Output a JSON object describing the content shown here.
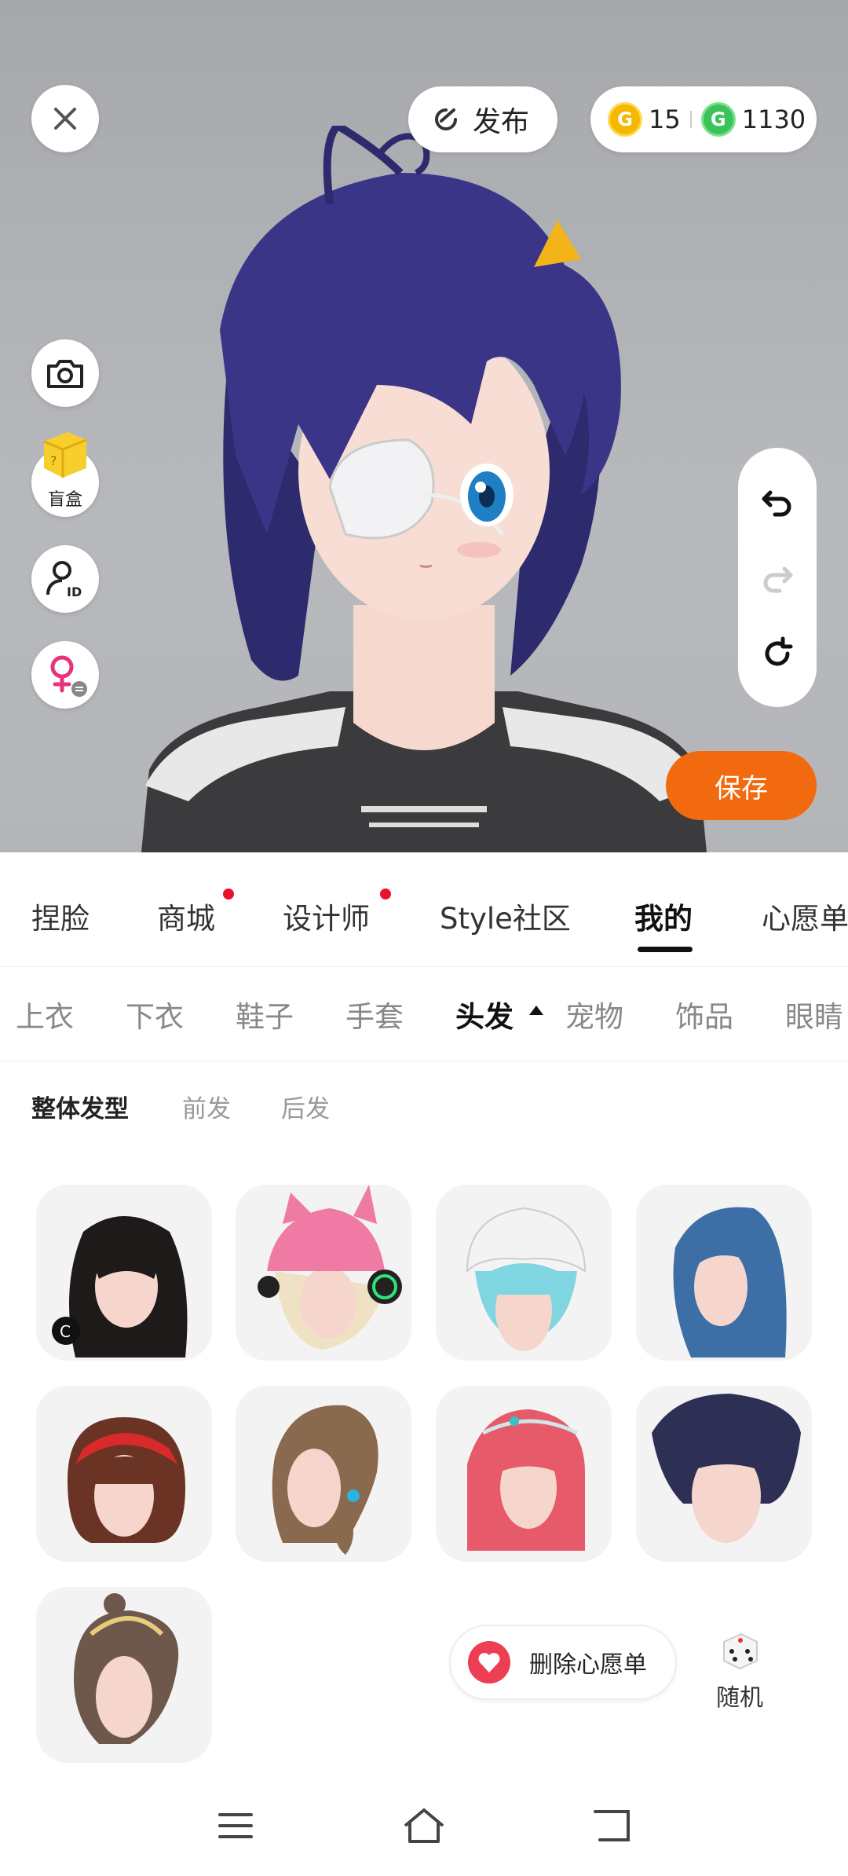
{
  "header": {
    "close_icon": "close-icon",
    "publish_label": "发布",
    "gold_coins": "15",
    "green_coins": "1130"
  },
  "left_tools": {
    "blindbox_label": "盲盒"
  },
  "save_label": "保存",
  "main_tabs": [
    {
      "label": "捏脸",
      "dot": false
    },
    {
      "label": "商城",
      "dot": true
    },
    {
      "label": "设计师",
      "dot": true
    },
    {
      "label": "Style社区",
      "dot": false
    },
    {
      "label": "我的",
      "dot": false,
      "active": true
    },
    {
      "label": "心愿单",
      "dot": false
    }
  ],
  "category_tabs": [
    {
      "label": "上衣"
    },
    {
      "label": "下衣"
    },
    {
      "label": "鞋子"
    },
    {
      "label": "手套"
    },
    {
      "label": "头发",
      "active": true
    },
    {
      "label": "宠物"
    },
    {
      "label": "饰品"
    },
    {
      "label": "眼睛"
    }
  ],
  "hair_subtabs": [
    {
      "label": "整体发型",
      "active": true
    },
    {
      "label": "前发"
    },
    {
      "label": "后发"
    }
  ],
  "hair_items": [
    {
      "name": "black-long-hair"
    },
    {
      "name": "pink-cat-cap-hair"
    },
    {
      "name": "cyan-bonnet-hair"
    },
    {
      "name": "blue-long-hair"
    },
    {
      "name": "brown-bob-hair"
    },
    {
      "name": "brown-side-ponytail-hair"
    },
    {
      "name": "pink-tiara-hair"
    },
    {
      "name": "navy-short-hair"
    },
    {
      "name": "updo-hair"
    }
  ],
  "wishlist_button": "删除心愿单",
  "random_label": "随机",
  "colors": {
    "accent": "#f26a0f",
    "active_text": "#111111",
    "inactive_text": "#888888",
    "red_dot": "#e8132c"
  }
}
